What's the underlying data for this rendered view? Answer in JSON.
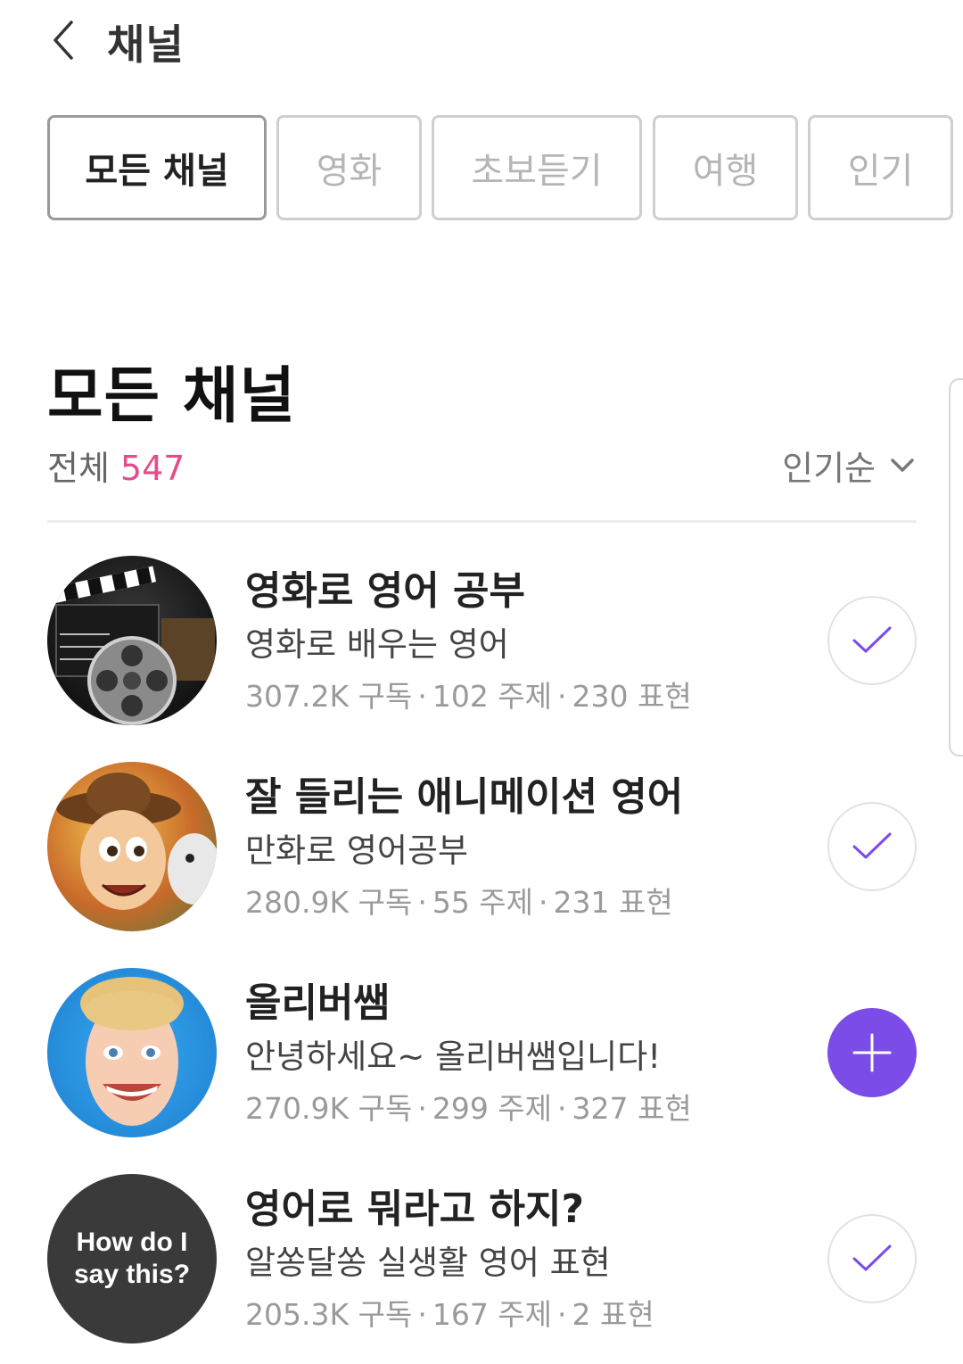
{
  "header": {
    "title": "채널",
    "back_icon": "chevron-left-icon"
  },
  "tabs": [
    {
      "label": "모든 채널",
      "active": true
    },
    {
      "label": "영화",
      "active": false
    },
    {
      "label": "초보듣기",
      "active": false
    },
    {
      "label": "여행",
      "active": false
    },
    {
      "label": "인기",
      "active": false
    }
  ],
  "section": {
    "title": "모든 채널",
    "count_label": "전체",
    "count_value": "547",
    "sort_label": "인기순",
    "sort_icon": "chevron-down-icon"
  },
  "colors": {
    "accent": "#7b4ce8",
    "count": "#e24d8a"
  },
  "channels": [
    {
      "title": "영화로 영어 공부",
      "description": "영화로 배우는 영어",
      "subscribers": "307.2K 구독",
      "topics": "102 주제",
      "expressions": "230 표현",
      "subscribed": true,
      "action_icon": "check-icon"
    },
    {
      "title": "잘 들리는 애니메이션 영어",
      "description": "만화로 영어공부",
      "subscribers": "280.9K 구독",
      "topics": "55 주제",
      "expressions": "231 표현",
      "subscribed": true,
      "action_icon": "check-icon"
    },
    {
      "title": "올리버쌤",
      "description": "안녕하세요~ 올리버쌤입니다!",
      "subscribers": "270.9K 구독",
      "topics": "299 주제",
      "expressions": "327 표현",
      "subscribed": false,
      "action_icon": "plus-icon"
    },
    {
      "title": "영어로 뭐라고 하지?",
      "description": "알쏭달쏭 실생활 영어 표현",
      "subscribers": "205.3K 구독",
      "topics": "167 주제",
      "expressions": "2 표현",
      "subscribed": true,
      "action_icon": "check-icon",
      "avatar_text": "How do I say this?"
    }
  ],
  "stats_separator": "·"
}
